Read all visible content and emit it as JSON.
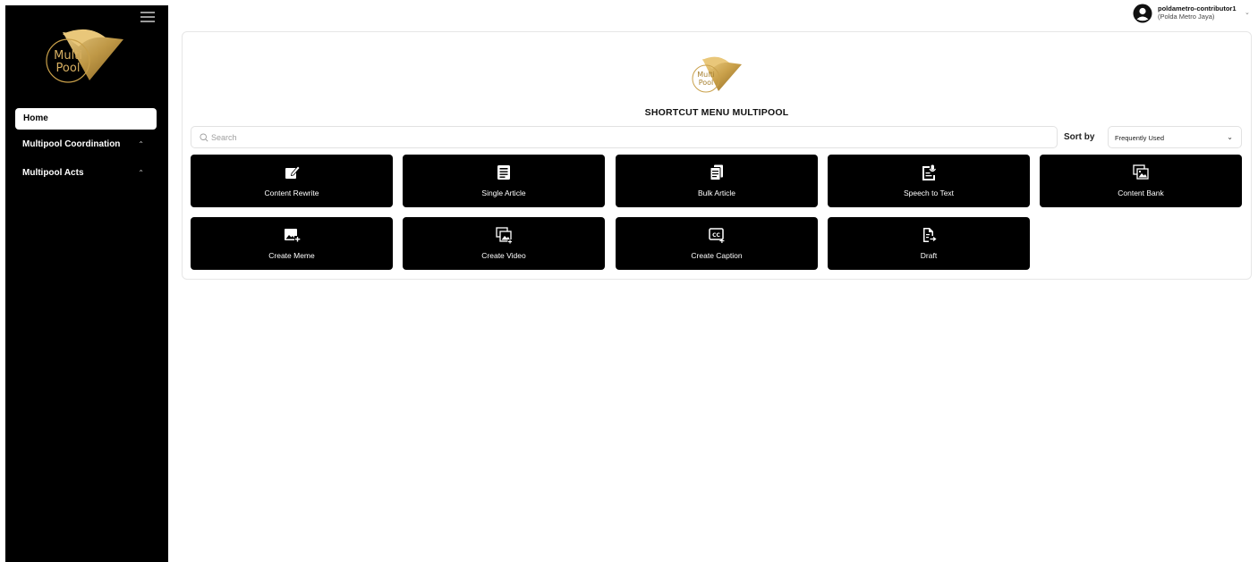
{
  "sidebar": {
    "logo_text": [
      "Multi",
      "Pool"
    ],
    "items": [
      {
        "label": "Home",
        "active": true
      },
      {
        "label": "Multipool Coordination",
        "chevron": "chevron-up-icon"
      },
      {
        "label": "Multipool Acts",
        "chevron": "chevron-up-icon"
      }
    ]
  },
  "user": {
    "name": "poldametro-contributor1",
    "role": "(Polda Metro Jaya)"
  },
  "main": {
    "title": "SHORTCUT MENU MULTIPOOL",
    "search": {
      "placeholder": "Search"
    },
    "sort": {
      "label": "Sort by",
      "selected": "Frequently Used"
    },
    "shortcuts": [
      {
        "label": "Content Rewrite",
        "icon": "edit-icon"
      },
      {
        "label": "Single Article",
        "icon": "article-icon"
      },
      {
        "label": "Bulk Article",
        "icon": "documents-icon"
      },
      {
        "label": "Speech to Text",
        "icon": "speech-text-icon"
      },
      {
        "label": "Content Bank",
        "icon": "images-icon"
      },
      {
        "label": "Create Meme",
        "icon": "add-image-icon"
      },
      {
        "label": "Create Video",
        "icon": "video-images-icon"
      },
      {
        "label": "Create Caption",
        "icon": "caption-icon"
      },
      {
        "label": "Draft",
        "icon": "draft-icon"
      }
    ]
  },
  "colors": {
    "brand_gold": "#c9a04a",
    "sidebar_bg": "#000000",
    "tile_bg": "#000000"
  }
}
